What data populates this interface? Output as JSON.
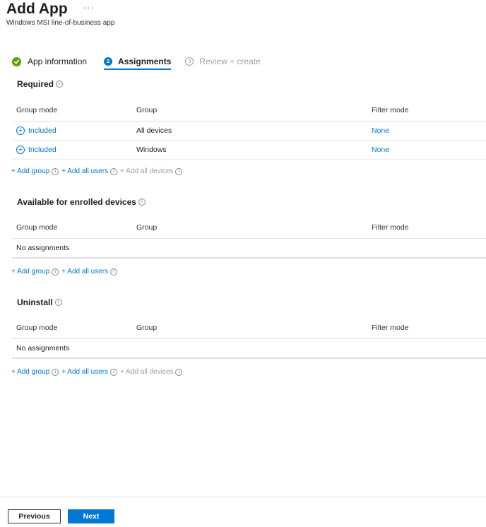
{
  "header": {
    "title": "Add App",
    "ellipsis": "···",
    "subtitle": "Windows MSI line-of-business app"
  },
  "steps": [
    {
      "label": "App information",
      "state": "done",
      "number": "1"
    },
    {
      "label": "Assignments",
      "state": "active",
      "number": "2"
    },
    {
      "label": "Review + create",
      "state": "pending",
      "number": "3"
    }
  ],
  "columns": {
    "group_mode": "Group mode",
    "group": "Group",
    "filter_mode": "Filter mode"
  },
  "sections": {
    "required": {
      "title": "Required",
      "rows": [
        {
          "mode": "Included",
          "group": "All devices",
          "filter": "None"
        },
        {
          "mode": "Included",
          "group": "Windows",
          "filter": "None"
        }
      ]
    },
    "available": {
      "title": "Available for enrolled devices",
      "empty": "No assignments"
    },
    "uninstall": {
      "title": "Uninstall",
      "empty": "No assignments"
    }
  },
  "actions": {
    "add_group": "+ Add group",
    "add_all_users": "+ Add all users",
    "add_all_devices": "+ Add all devices"
  },
  "footer": {
    "previous": "Previous",
    "next": "Next"
  },
  "colors": {
    "accent": "#0078d4",
    "success": "#57a300",
    "disabled": "#a19f9d"
  }
}
